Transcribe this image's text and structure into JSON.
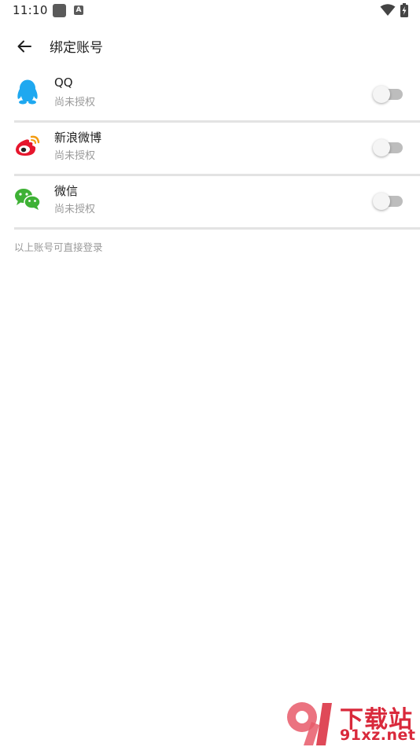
{
  "status_bar": {
    "time": "11:10",
    "icons": [
      "notification-square-icon",
      "keyboard-a-icon",
      "wifi-icon",
      "battery-charging-icon"
    ]
  },
  "app_bar": {
    "back_icon": "arrow-left-icon",
    "title": "绑定账号"
  },
  "accounts": [
    {
      "name": "QQ",
      "status": "尚未授权",
      "icon": "qq-icon",
      "color": "#1ea8f0",
      "enabled": false
    },
    {
      "name": "新浪微博",
      "status": "尚未授权",
      "icon": "weibo-icon",
      "color": "#e6162d",
      "enabled": false
    },
    {
      "name": "微信",
      "status": "尚未授权",
      "icon": "wechat-icon",
      "color": "#3eb135",
      "enabled": false
    }
  ],
  "footer_note": "以上账号可直接登录",
  "watermark": {
    "logo_text": "91",
    "title": "下载站",
    "url": "91xz.net",
    "color": "#d9293b"
  },
  "colors": {
    "divider": "#e3e3e3",
    "secondary_text": "#9a9a9a",
    "toggle_track_off": "#bdbdbd",
    "toggle_thumb_off": "#f5f5f5"
  }
}
